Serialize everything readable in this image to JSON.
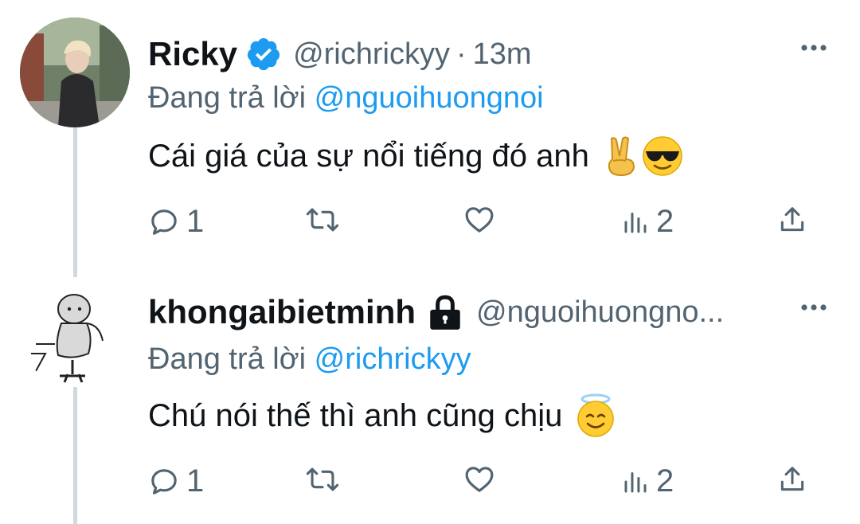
{
  "tweets": [
    {
      "name": "Ricky",
      "badge": "verified-badge-icon",
      "handle": "@richrickyy",
      "separator": "·",
      "time": "13m",
      "reply_prefix": "Đang trả lời",
      "reply_to": "@nguoihuongnoi",
      "text": "Cái giá của sự nổi tiếng đó anh",
      "emojis": [
        "victory-hand-emoji",
        "sunglasses-face-emoji"
      ],
      "actions": {
        "reply_count": "1",
        "retweet_count": "",
        "like_count": "",
        "views_count": "2"
      }
    },
    {
      "name": "khongaibietminh",
      "badge": "lock-icon",
      "handle": "@nguoihuongno...",
      "reply_prefix": "Đang trả lời",
      "reply_to": "@richrickyy",
      "text": "Chú nói thế thì anh cũng chịu",
      "emojis": [
        "smiling-face-with-halo-emoji"
      ],
      "actions": {
        "reply_count": "1",
        "retweet_count": "",
        "like_count": "",
        "views_count": "2"
      }
    }
  ],
  "colors": {
    "link": "#1d9bf0",
    "verified": "#1d9bf0",
    "secondary_text": "#536471",
    "thread_line": "#cfd9de"
  }
}
